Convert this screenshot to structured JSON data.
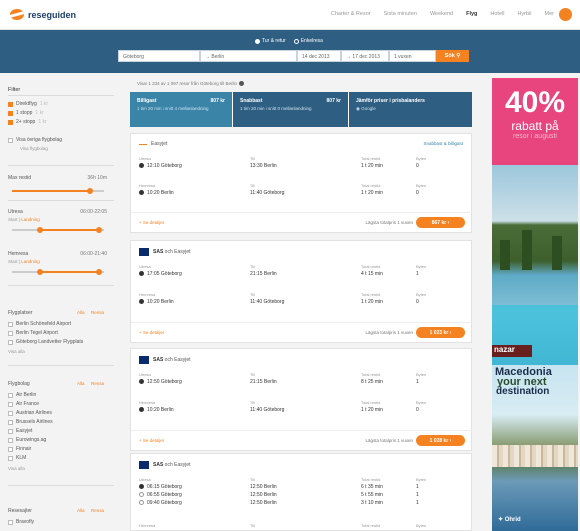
{
  "header": {
    "logo_text": "reseguiden",
    "nav": [
      "Charter & Resor",
      "Sista minuten",
      "Weekend",
      "Flyg",
      "Hotell",
      "Hyrbil",
      "Mer"
    ],
    "active": "Flyg"
  },
  "search": {
    "trip_types": [
      "Tur & retur",
      "Enkelresa"
    ],
    "from": "Göteborg",
    "to": "Berlin",
    "depart": "14 dec 2013",
    "return": "17 dec 2013",
    "passengers": "1 vuxen",
    "button": "Sök"
  },
  "filters": {
    "title": "Filter",
    "stops": [
      {
        "label": "Direktflyg",
        "price": "1 kr",
        "on": true
      },
      {
        "label": "1 stopp",
        "price": "1 kr",
        "on": true
      },
      {
        "label": "2+ stopp",
        "price": "1 kr",
        "on": true
      }
    ],
    "nearby": "Visa övriga flygbolag",
    "nearby_link": "Visa flygbolag",
    "travel_time": {
      "label": "Max restid",
      "value": "36h 10m",
      "fill": 0.85
    },
    "outbound": {
      "label": "Utresa",
      "value": "06:00-22:05",
      "sub": "Start",
      "sublink": "Landning",
      "range": [
        0.3,
        0.95
      ]
    },
    "inbound": {
      "label": "Hemresa",
      "value": "06:00-21:40",
      "sub": "Start",
      "sublink": "Landning",
      "range": [
        0.3,
        0.95
      ]
    },
    "airports": {
      "title": "Flygplatser",
      "all": "Alla",
      "none": "Rensa",
      "items": [
        "Berlin Schönefeld Airport",
        "Berlin Tegel Airport",
        "Göteborg Landvetter Flygplats"
      ],
      "more": "Visa alla"
    },
    "airlines": {
      "title": "Flygbolag",
      "all": "Alla",
      "none": "Rensa",
      "items": [
        "Air Berlin",
        "Air France",
        "Austrian Airlines",
        "Brussels Airlines",
        "Easyjet",
        "Eurowings.ag",
        "Finnair",
        "KLM"
      ],
      "more": "Visa alla"
    },
    "sites": {
      "title": "Resesajter",
      "all": "Alla",
      "none": "Rensa",
      "items": [
        "Bravofly"
      ]
    }
  },
  "results": {
    "count_text": "Visar 1 234 av 1 097 resor från Göteborg till Berlin",
    "tabs": [
      {
        "name": "Billigast",
        "price": "807 kr",
        "sub": "1 tim 20 min i snitt 4 mellanlandning"
      },
      {
        "name": "Snabbast",
        "price": "807 kr",
        "sub": "1 tim 20 min i snitt 0 mellanlandning"
      },
      {
        "name": "Jämför priser i prisbalanders",
        "price": "",
        "sub": "Google"
      }
    ],
    "cards": [
      {
        "airline": "Easyjet",
        "link": "Snabbast & billigast",
        "segments": [
          {
            "dir": "Utresa",
            "time": "12:10 Göteborg",
            "to_label": "Till",
            "to": "13:30 Berlin",
            "dur_label": "Total restid",
            "dur": "1 t 20 min",
            "stops_label": "Byten",
            "stops": "0"
          },
          {
            "dir": "Hemresa",
            "time": "10:20 Berlin",
            "to_label": "Till",
            "to": "11:40 Göteborg",
            "dur_label": "Total restid",
            "dur": "1 t 20 min",
            "stops_label": "Byten",
            "stops": "0"
          }
        ],
        "details": "+ Se detaljer",
        "price": "Lägsta totalpris 1 vuxen",
        "button": "867 kr"
      },
      {
        "airline": "SAS",
        "airline_suffix": "och Easyjet",
        "segments": [
          {
            "dir": "Utresa",
            "time": "17:05 Göteborg",
            "to_label": "Till",
            "to": "21:15 Berlin",
            "dur_label": "Total restid",
            "dur": "4 t 15 min",
            "stops_label": "Byten",
            "stops": "1"
          },
          {
            "dir": "Hemresa",
            "time": "10:20 Berlin",
            "to_label": "Till",
            "to": "11:40 Göteborg",
            "dur_label": "Total restid",
            "dur": "1 t 20 min",
            "stops_label": "Byten",
            "stops": "0"
          }
        ],
        "details": "+ Se detaljer",
        "price": "Lägsta totalpris 1 vuxen",
        "button": "1 023 kr"
      },
      {
        "airline": "SAS",
        "airline_suffix": "och Easyjet",
        "segments": [
          {
            "dir": "Utresa",
            "time": "12:50 Göteborg",
            "to_label": "Till",
            "to": "21:15 Berlin",
            "dur_label": "Total restid",
            "dur": "8 t 25 min",
            "stops_label": "Byten",
            "stops": "1"
          },
          {
            "dir": "Hemresa",
            "time": "10:20 Berlin",
            "to_label": "Till",
            "to": "11:40 Göteborg",
            "dur_label": "Total restid",
            "dur": "1 t 20 min",
            "stops_label": "Byten",
            "stops": "0"
          }
        ],
        "details": "+ Se detaljer",
        "price": "Lägsta totalpris 1 vuxen",
        "button": "1 028 kr"
      },
      {
        "airline": "SAS",
        "airline_suffix": "och Easyjet",
        "segments": [
          {
            "dir": "Utresa",
            "time": "06:15 Göteborg",
            "to_label": "Till",
            "to": "12:50 Berlin",
            "dur_label": "Total restid",
            "dur": "6 t 35 min",
            "stops_label": "Byten",
            "stops": "1"
          },
          {
            "dir": "",
            "time": "06:55 Göteborg",
            "to_label": "",
            "to": "12:50 Berlin",
            "dur_label": "",
            "dur": "5 t 55 min",
            "stops_label": "",
            "stops": "1"
          },
          {
            "dir": "",
            "time": "09:40 Göteborg",
            "to_label": "",
            "to": "12:50 Berlin",
            "dur_label": "",
            "dur": "3 t 10 min",
            "stops_label": "",
            "stops": "1"
          },
          {
            "dir": "Hemresa",
            "time": "",
            "to_label": "Till",
            "to": "",
            "dur_label": "Total restid",
            "dur": "",
            "stops_label": "Byten",
            "stops": ""
          }
        ]
      }
    ]
  },
  "ads": {
    "ad1": {
      "big": "40%",
      "line2": "rabatt på",
      "line3": "resor i augusti"
    },
    "ad2": {
      "brand": "nazar"
    },
    "ad3": {
      "t1": "Macedonia",
      "t2": "your next",
      "t3": "destination",
      "city": "Ohrid"
    }
  }
}
